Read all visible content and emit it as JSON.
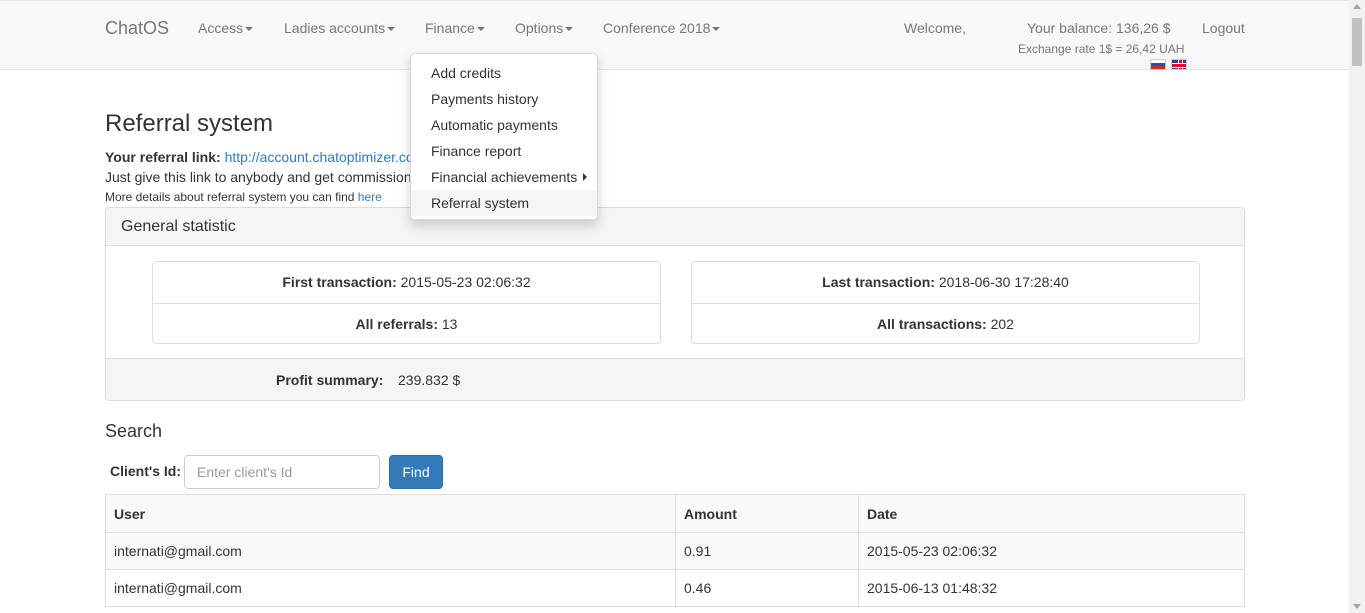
{
  "navbar": {
    "brand": "ChatOS",
    "items": [
      {
        "label": "Access"
      },
      {
        "label": "Ladies accounts"
      },
      {
        "label": "Finance"
      },
      {
        "label": "Options"
      },
      {
        "label": "Conference 2018"
      }
    ],
    "welcome": "Welcome,",
    "balance": "Your balance: 136,26 $",
    "exchange_rate": "Exchange rate 1$ = 26,42 UAH",
    "logout": "Logout",
    "flags": [
      "russian-flag-icon",
      "english-flag-icon"
    ]
  },
  "finance_menu": {
    "items": [
      {
        "label": "Add credits"
      },
      {
        "label": "Payments history"
      },
      {
        "label": "Automatic payments"
      },
      {
        "label": "Finance report"
      },
      {
        "label": "Financial achievements"
      },
      {
        "label": "Referral system"
      }
    ]
  },
  "page": {
    "title": "Referral system",
    "referral_link_label": "Your referral link:",
    "referral_link_visible": "http://account.chatoptimizer.co",
    "give_text_visible": "Just give this link to anybody and get commission",
    "more_details_text": "More details about referral system you can find",
    "more_details_link": "here"
  },
  "general_statistic": {
    "title": "General statistic",
    "first_transaction_label": "First transaction:",
    "first_transaction_value": "2015-05-23 02:06:32",
    "all_referrals_label": "All referrals:",
    "all_referrals_value": "13",
    "last_transaction_label": "Last transaction:",
    "last_transaction_value": "2018-06-30 17:28:40",
    "all_transactions_label": "All transactions:",
    "all_transactions_value": "202",
    "profit_label": "Profit summary:",
    "profit_value": "239.832 $"
  },
  "search": {
    "title": "Search",
    "client_label": "Client's Id:",
    "client_placeholder": "Enter client's Id",
    "find_label": "Find"
  },
  "table": {
    "headers": [
      "User",
      "Amount",
      "Date"
    ],
    "rows": [
      [
        "internati@gmail.com",
        "0.91",
        "2015-05-23 02:06:32"
      ],
      [
        "internati@gmail.com",
        "0.46",
        "2015-06-13 01:48:32"
      ]
    ]
  },
  "colors": {
    "primary": "#337ab7",
    "navbar_bg": "#f8f8f8",
    "panel_bg": "#f5f5f5"
  }
}
